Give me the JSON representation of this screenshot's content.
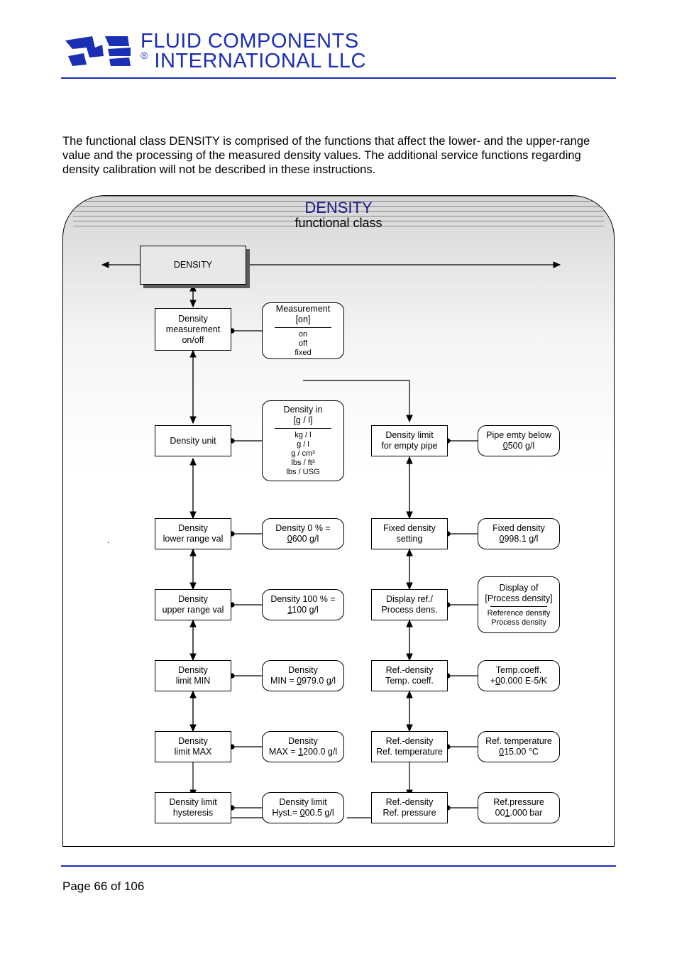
{
  "logo": {
    "line1": "FLUID COMPONENTS",
    "line2": "INTERNATIONAL LLC"
  },
  "intro": "The functional class DENSITY is comprised of the functions that affect the lower- and the upper-range value and the processing of the measured density values. The additional service functions regarding density calibration will not be described in these instructions.",
  "diagram": {
    "title": "DENSITY",
    "subtitle": "functional class",
    "top": "DENSITY",
    "left": {
      "meas_onoff": {
        "l1": "Density",
        "l2": "measurement",
        "l3": "on/off"
      },
      "unit": "Density unit",
      "lrv": {
        "l1": "Density",
        "l2": "lower range val"
      },
      "urv": {
        "l1": "Density",
        "l2": "upper range val"
      },
      "lmin": {
        "l1": "Density",
        "l2": "limit MIN"
      },
      "lmax": {
        "l1": "Density",
        "l2": "limit MAX"
      },
      "lhyst": {
        "l1": "Density  limit",
        "l2": "hysteresis"
      }
    },
    "mid_r": {
      "meas": {
        "l1": "Measurement",
        "l2": "[on]",
        "opts": [
          "on",
          "off",
          "fixed"
        ]
      },
      "unit": {
        "l1": "Density in",
        "l2": "[g / l]",
        "opts": [
          "kg / l",
          "g / l",
          "g / cm³",
          "lbs / ft³",
          "lbs / USG"
        ]
      },
      "d0": {
        "l1": "Density 0 % =",
        "ul": "0",
        "rest": "600 g/l"
      },
      "d100": {
        "l1": "Density 100 % =",
        "ul": "1",
        "rest": "100 g/l"
      },
      "dmin": {
        "l1": "Density",
        "l2pre": "MIN = ",
        "ul": "0",
        "rest": "979.0 g/l"
      },
      "dmax": {
        "l1": "Density",
        "l2pre": "MAX = ",
        "ul": "1",
        "rest": "200.0 g/l"
      },
      "dhyst": {
        "l1": "Density limit",
        "l2pre": "Hyst.= ",
        "ul": "0",
        "rest": "00.5 g/l"
      }
    },
    "right_left": {
      "empty": {
        "l1": "Density limit",
        "l2": "for empty  pipe"
      },
      "fixed": {
        "l1": "Fixed density",
        "l2": "setting"
      },
      "display": {
        "l1": "Display ref./",
        "l2": "Process dens."
      },
      "tcoeff": {
        "l1": "Ref.-density",
        "l2": "Temp. coeff."
      },
      "rtemp": {
        "l1": "Ref.-density",
        "l2": "Ref. temperature"
      },
      "rpress": {
        "l1": "Ref.-density",
        "l2": "Ref. pressure"
      }
    },
    "right_r": {
      "empty": {
        "l1": "Pipe emty below",
        "ul": "0",
        "rest": "500 g/l"
      },
      "fixed": {
        "l1": "Fixed density",
        "ul": "0",
        "rest": "998.1 g/l"
      },
      "display": {
        "l1": "Display of",
        "l2": "[Process density]",
        "opts": [
          "Reference density",
          "Process density"
        ]
      },
      "tcoeff": {
        "l1": "Temp.coeff.",
        "pre": "+",
        "ul": "0",
        "rest": "0.000 E-5/K"
      },
      "rtemp": {
        "l1": "Ref. temperature",
        "ul": "0",
        "rest": "15.00 °C"
      },
      "rpress": {
        "l1": "Ref.pressure",
        "pre": "00",
        "ul": "1",
        "rest": ".000 bar"
      }
    }
  },
  "footer": {
    "page": "Page 66 of 106"
  }
}
